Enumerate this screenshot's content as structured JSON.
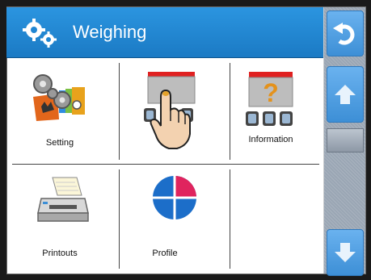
{
  "header": {
    "title": "Weighing"
  },
  "menu": {
    "items": [
      {
        "label": "Setting"
      },
      {
        "label": ""
      },
      {
        "label": "Information"
      },
      {
        "label": "Printouts"
      },
      {
        "label": "Profile"
      },
      {
        "label": ""
      }
    ]
  },
  "icons": {
    "app": "gears-icon",
    "back": "undo-arrow-icon",
    "up": "scroll-up-icon",
    "down": "scroll-down-icon"
  },
  "colors": {
    "header": "#1f86d3",
    "accent_blue": "#3d8fd6",
    "profile_red": "#e0245e",
    "profile_blue": "#1c6ec9"
  }
}
